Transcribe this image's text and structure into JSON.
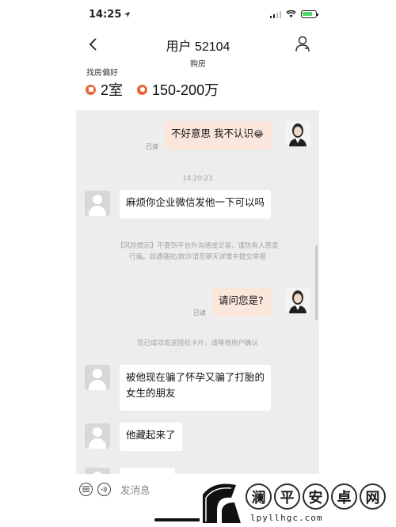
{
  "status_bar": {
    "time": "14:25",
    "location_icon": "location-arrow-icon",
    "signal_icon": "signal-icon",
    "wifi_icon": "wifi-icon",
    "battery_icon": "battery-charging-icon"
  },
  "header": {
    "back_icon": "chevron-left-icon",
    "title": "用户 52104",
    "subtitle": "购房",
    "user_icon": "user-profile-icon"
  },
  "preferences": {
    "label": "找房偏好",
    "items": [
      {
        "icon": "house-icon",
        "value": "2室"
      },
      {
        "icon": "price-icon",
        "value": "150-200万"
      }
    ]
  },
  "messages": [
    {
      "side": "out",
      "text": "不好意思  我不认识",
      "emoji": "😂",
      "status": "已读"
    },
    {
      "type": "time",
      "text": "14:20:23"
    },
    {
      "side": "in",
      "text": "麻烦你企业微信发他一下可以吗"
    },
    {
      "type": "notice",
      "lines": [
        "【风险提示】不要到平台外沟通或交易，谨防有人恶意",
        "行骗。如遇骚扰/欺诈请至聊天详情中提交举报"
      ]
    },
    {
      "side": "out",
      "text": "请问您是?",
      "status": "已读"
    },
    {
      "type": "notice",
      "lines": [
        "您已成功发送授权卡片，请等待用户确认"
      ]
    },
    {
      "side": "in",
      "lines": [
        "被他现在骗了怀孕又骗了打胎的",
        "女生的朋友"
      ]
    },
    {
      "side": "in",
      "text": "他藏起来了"
    }
  ],
  "input_bar": {
    "list_icon": "list-icon",
    "voice_icon": "voice-icon",
    "placeholder": "发消息"
  },
  "watermark": {
    "chars": [
      "澜",
      "平",
      "安",
      "卓",
      "网"
    ],
    "url": "lpyllhgc.com"
  }
}
